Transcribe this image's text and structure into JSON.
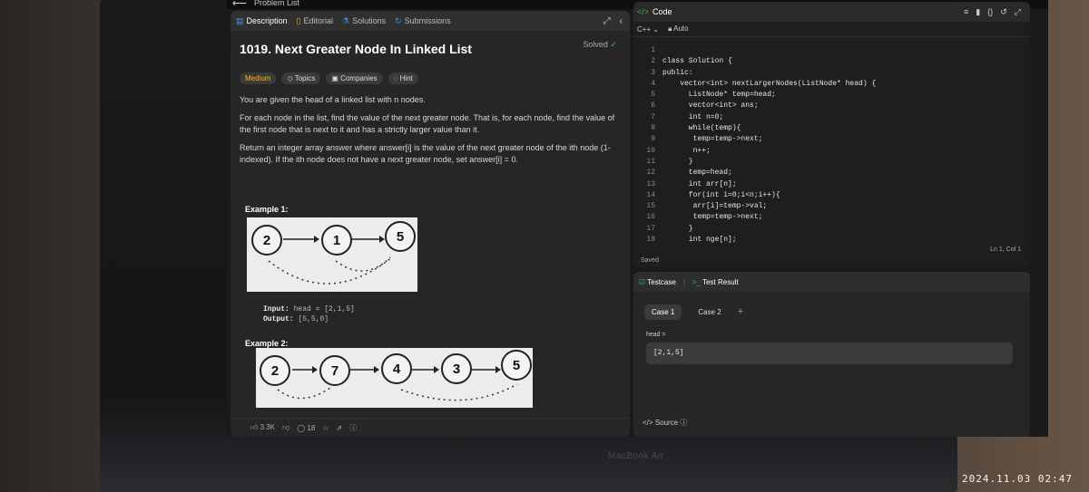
{
  "topbar": {
    "title": "Problem List"
  },
  "tabs": [
    {
      "label": "Description"
    },
    {
      "label": "Editorial"
    },
    {
      "label": "Solutions"
    },
    {
      "label": "Submissions"
    }
  ],
  "problem": {
    "title": "1019. Next Greater Node In Linked List",
    "status": "Solved",
    "badges": [
      "Medium",
      "Topics",
      "Companies",
      "Hint"
    ],
    "p1": "You are given the head of a linked list with n nodes.",
    "p2": "For each node in the list, find the value of the next greater node. That is, for each node, find the value of the first node that is next to it and has a strictly larger value than it.",
    "p3": "Return an integer array answer where answer[i] is the value of the next greater node of the ith node (1-indexed). If the ith node does not have a next greater node, set answer[i] = 0."
  },
  "example1": {
    "title": "Example 1:",
    "nodes": [
      "2",
      "1",
      "5"
    ],
    "input_label": "Input:",
    "input": "head = [2,1,5]",
    "output_label": "Output:",
    "output": "[5,5,0]"
  },
  "example2": {
    "title": "Example 2:",
    "nodes": [
      "2",
      "7",
      "4",
      "3",
      "5"
    ]
  },
  "footer": {
    "likes": "3.3K",
    "comments": "18"
  },
  "code": {
    "header": "Code",
    "language": "C++",
    "mode": "Auto",
    "lines": [
      "",
      "class Solution {",
      "public:",
      "    vector<int> nextLargerNodes(ListNode* head) {",
      "      ListNode* temp=head;",
      "      vector<int> ans;",
      "      int n=0;",
      "      while(temp){",
      "       temp=temp->next;",
      "       n++;",
      "      }",
      "      temp=head;",
      "      int arr[n];",
      "      for(int i=0;i<n;i++){",
      "       arr[i]=temp->val;",
      "       temp=temp->next;",
      "      }",
      "      int nge[n];"
    ],
    "saved": "Saved",
    "cursor": "Ln 1, Col 1"
  },
  "testcase": {
    "tab1": "Testcase",
    "tab2": "Test Result",
    "cases": [
      "Case 1",
      "Case 2"
    ],
    "param_label": "head =",
    "param_value": "[2,1,5]",
    "source": "Source"
  },
  "device": {
    "brand": "MacBook Air"
  },
  "timestamp": "2024.11.03 02:47"
}
